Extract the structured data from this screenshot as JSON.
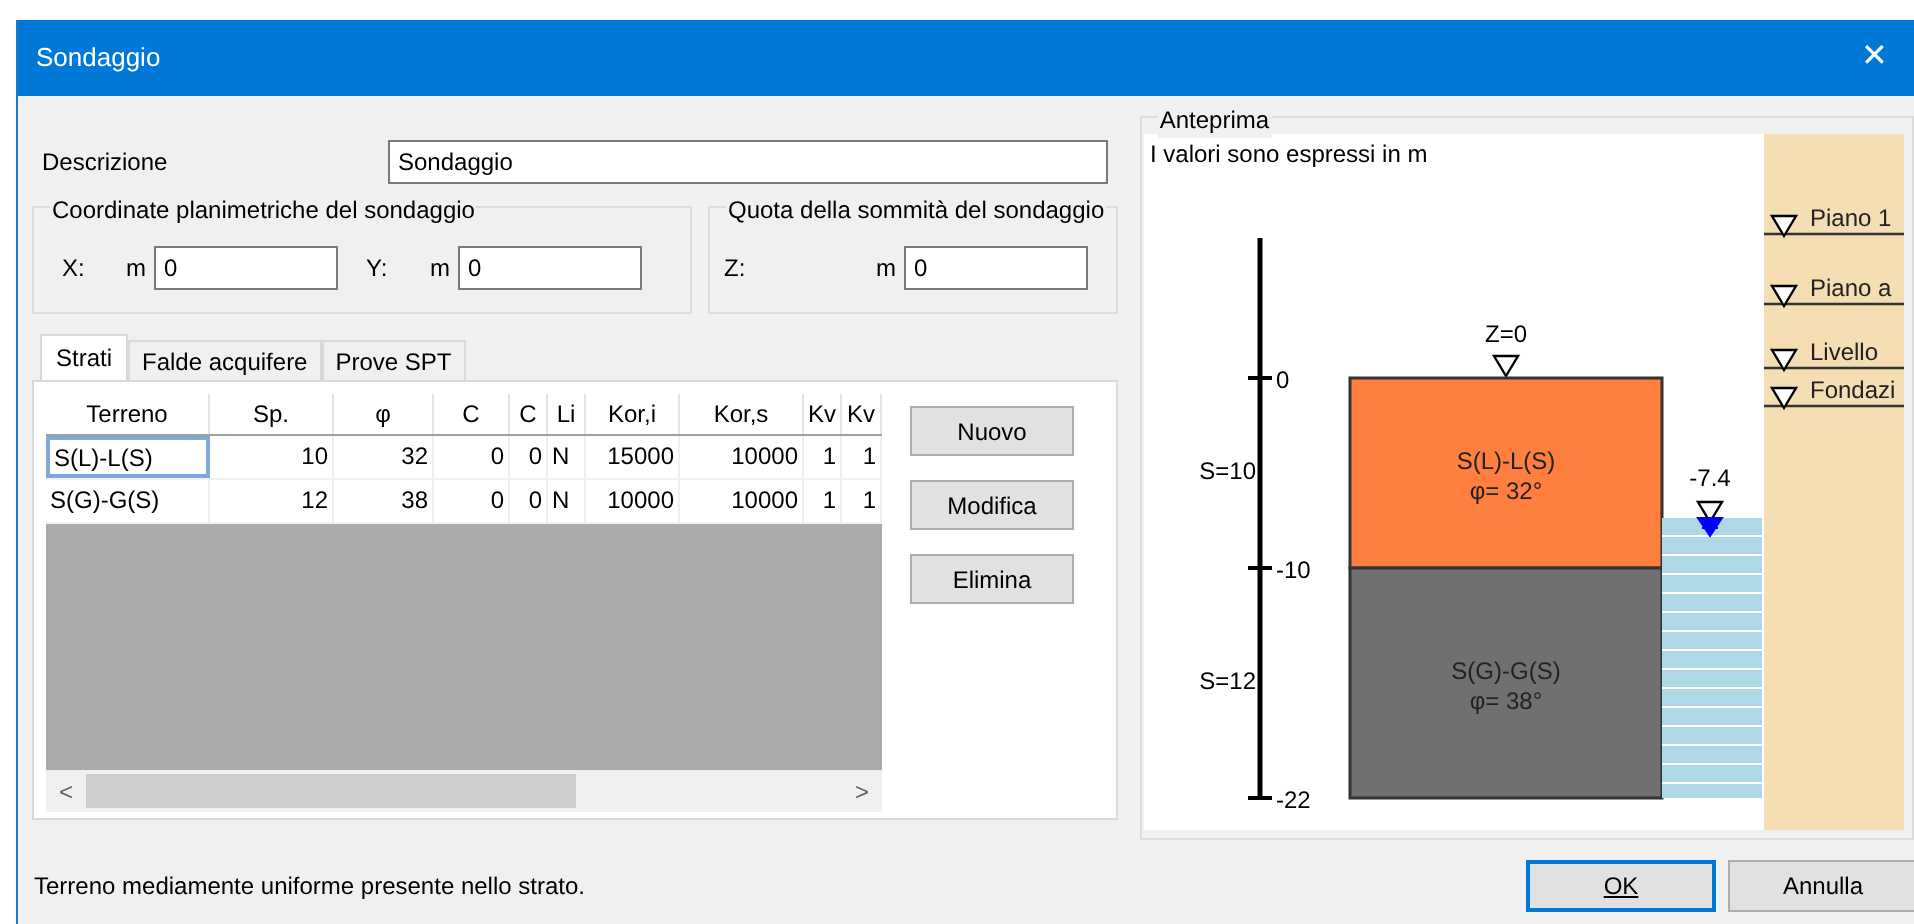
{
  "window": {
    "title": "Sondaggio",
    "close": "✕"
  },
  "description": {
    "label": "Descrizione",
    "value": "Sondaggio"
  },
  "coordinates": {
    "title": "Coordinate planimetriche del sondaggio",
    "fields": [
      {
        "label": "X:",
        "unit": "m",
        "value": "0"
      },
      {
        "label": "Y:",
        "unit": "m",
        "value": "0"
      }
    ]
  },
  "elevation": {
    "title": "Quota della sommità del sondaggio",
    "label": "Z:",
    "unit": "m",
    "value": "0"
  },
  "tabs": [
    {
      "label": "Strati",
      "selected": true
    },
    {
      "label": "Falde acquifere",
      "selected": false
    },
    {
      "label": "Prove SPT",
      "selected": false
    }
  ],
  "table": {
    "columns": [
      "Terreno",
      "Sp.",
      "φ",
      "C",
      "C",
      "Li",
      "Kor,i",
      "Kor,s",
      "Kv",
      "Kv"
    ],
    "rows": [
      {
        "cells": [
          "S(L)-L(S)",
          "10",
          "32",
          "0",
          "0",
          "N",
          "15000",
          "10000",
          "1",
          "1"
        ],
        "selected": true
      },
      {
        "cells": [
          "S(G)-G(S)",
          "12",
          "38",
          "0",
          "0",
          "N",
          "10000",
          "10000",
          "1",
          "1"
        ],
        "selected": false
      }
    ],
    "scroll_left": "<",
    "scroll_right": ">"
  },
  "actions": [
    "Nuovo",
    "Modifica",
    "Elimina"
  ],
  "preview": {
    "title": "Anteprima",
    "note": "I valori sono espressi in m",
    "scale_ticks": [
      "0",
      "-10",
      "-22"
    ],
    "top_label": "Z=0",
    "layers": [
      {
        "name": "S(L)-L(S)",
        "phi": "φ= 32°",
        "thickness": "S=10",
        "color": "#ff7f3f"
      },
      {
        "name": "S(G)-G(S)",
        "phi": "φ= 38°",
        "thickness": "S=12",
        "color": "#707070"
      }
    ],
    "water": {
      "label": "-7.4"
    },
    "levels": [
      "Piano 1",
      "Piano a",
      "Livello",
      "Fondazi"
    ]
  },
  "status": "Terreno mediamente uniforme presente nello strato.",
  "buttons": [
    {
      "label": "OK",
      "default": true
    },
    {
      "label": "Annulla",
      "default": false
    }
  ]
}
